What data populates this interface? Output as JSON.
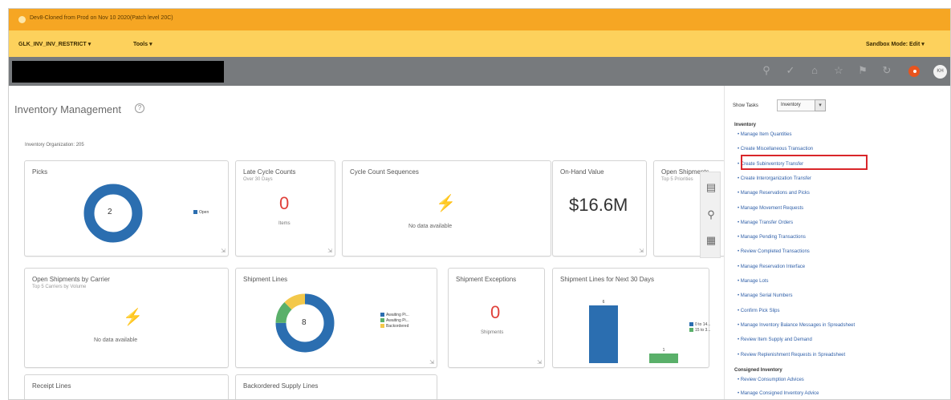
{
  "banner": {
    "text": "Dev8-Cloned from Prod on Nov 10 2020(Patch level 20C)"
  },
  "toolbar": {
    "sandbox": "GLK_INV_INV_RESTRICT ▾",
    "tools": "Tools ▾",
    "mode": "Sandbox Mode: Edit ▾"
  },
  "header": {
    "icons": [
      "search-icon",
      "pin-icon",
      "home-icon",
      "star-icon",
      "flag-icon",
      "notification-icon"
    ],
    "avatar": "KH",
    "colors": {
      "banner": "#f6a623",
      "toolbar": "#fdd15c",
      "header": "#777a7d",
      "badge": "#e8541e"
    }
  },
  "page": {
    "title": "Inventory Management",
    "help": "?",
    "org_label": "Inventory Organization: 205"
  },
  "tiles": {
    "picks": {
      "title": "Picks",
      "value": "2",
      "legend": "Open"
    },
    "late_cycle": {
      "title": "Late Cycle Counts",
      "subtitle": "Over 30 Days",
      "value": "0",
      "caption": "Items"
    },
    "cycle_seq": {
      "title": "Cycle Count Sequences",
      "nodata": "No data available"
    },
    "on_hand": {
      "title": "On-Hand Value",
      "value": "$16.6M"
    },
    "open_shipments": {
      "title": "Open Shipments",
      "subtitle": "Top 5 Priorities"
    },
    "open_ship_carrier": {
      "title": "Open Shipments by Carrier",
      "subtitle": "Top 5 Carriers by Volume",
      "nodata": "No data available"
    },
    "shipment_lines": {
      "title": "Shipment Lines",
      "value": "8",
      "legend": [
        "Awaiting Pi...",
        "Awaiting Pi...",
        "Backordered"
      ]
    },
    "shipment_exc": {
      "title": "Shipment Exceptions",
      "value": "0",
      "caption": "Shipments"
    },
    "lines_next30": {
      "title": "Shipment Lines for Next 30 Days",
      "bar_labels": [
        "6",
        "1"
      ],
      "legend": [
        "0 to 14...",
        "15 to 3..."
      ]
    },
    "receipt_lines": {
      "title": "Receipt Lines"
    },
    "backordered": {
      "title": "Backordered Supply Lines"
    }
  },
  "chart_data": [
    {
      "type": "pie",
      "title": "Picks",
      "categories": [
        "Open"
      ],
      "values": [
        2
      ]
    },
    {
      "type": "pie",
      "title": "Shipment Lines",
      "categories": [
        "Awaiting Pi...",
        "Awaiting Pi...",
        "Backordered"
      ],
      "values": [
        6,
        1,
        1
      ]
    },
    {
      "type": "bar",
      "title": "Shipment Lines for Next 30 Days",
      "categories": [
        "0 to 14...",
        "15 to 3..."
      ],
      "values": [
        6,
        1
      ]
    }
  ],
  "tasks": {
    "show_label": "Show Tasks",
    "filter": "Inventory",
    "section1": "Inventory",
    "items": [
      "Manage Item Quantities",
      "Create Miscellaneous Transaction",
      "Create Subinventory Transfer",
      "Create Interorganization Transfer",
      "Manage Reservations and Picks",
      "Manage Movement Requests",
      "Manage Transfer Orders",
      "Manage Pending Transactions",
      "Review Completed Transactions",
      "Manage Reservation Interface",
      "Manage Lots",
      "Manage Serial Numbers",
      "Confirm Pick Slips",
      "Manage Inventory Balance Messages in Spreadsheet",
      "Review Item Supply and Demand",
      "Review Replenishment Requests in Spreadsheet"
    ],
    "section2": "Consigned Inventory",
    "items2": [
      "Review Consumption Advices",
      "Manage Consigned Inventory Advice"
    ]
  }
}
